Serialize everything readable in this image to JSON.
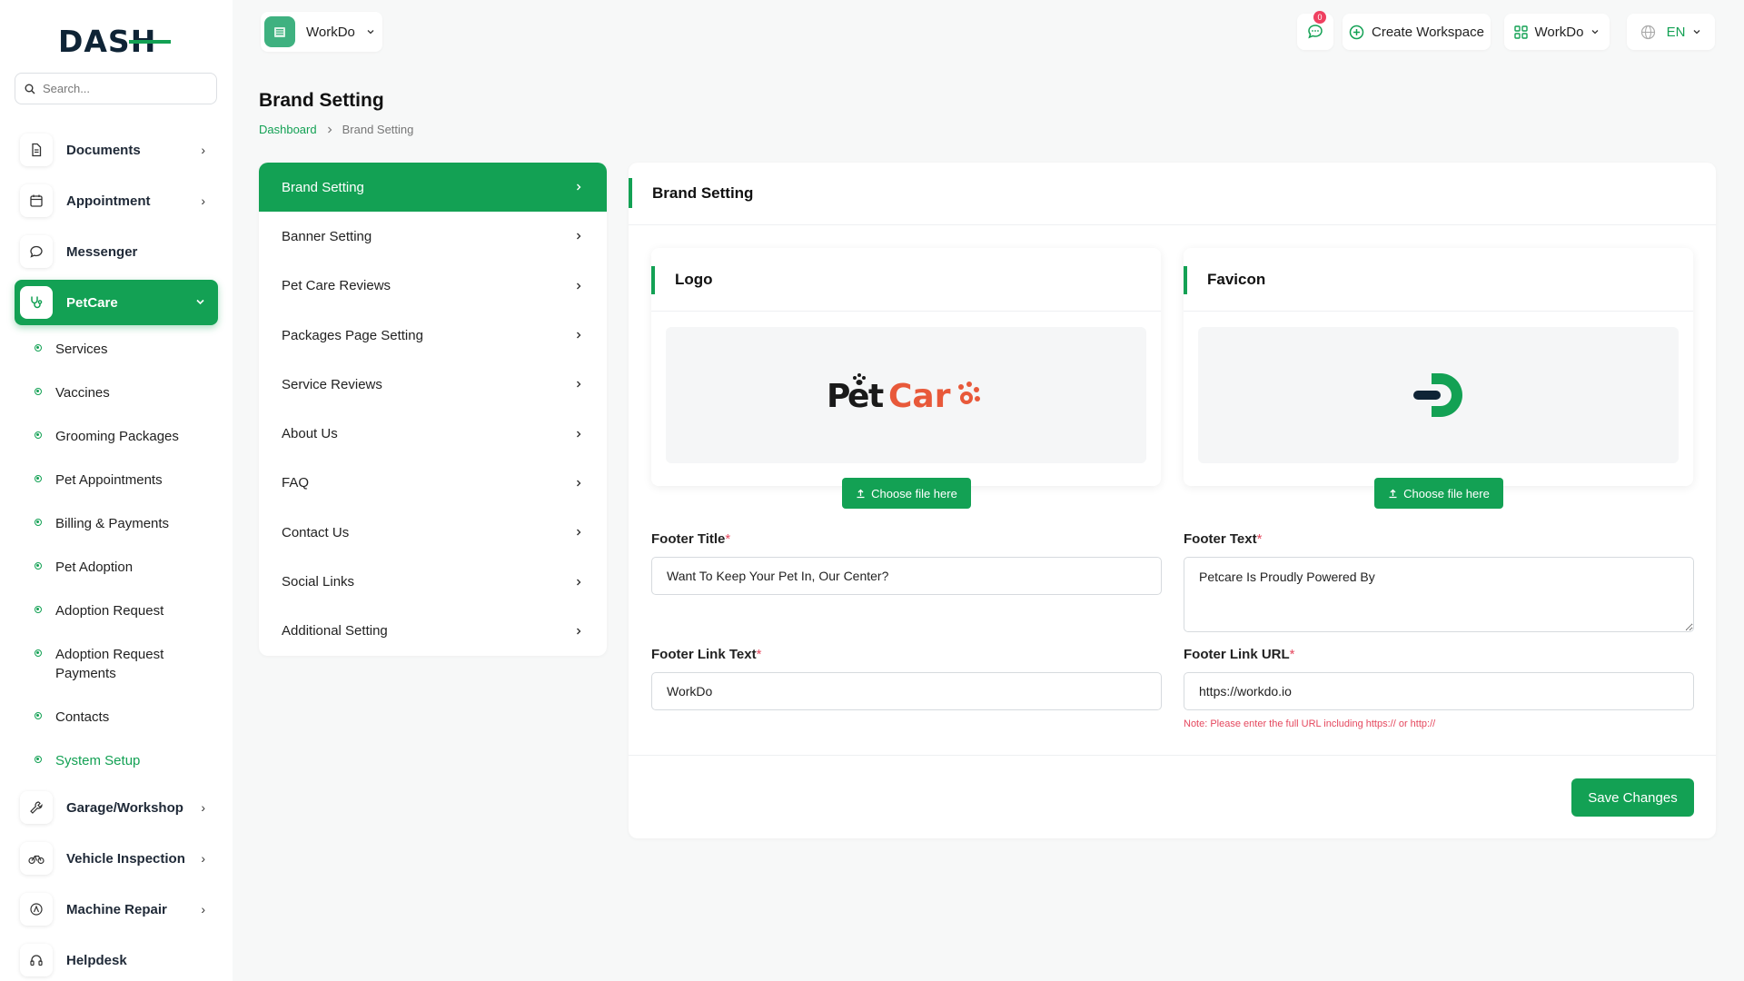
{
  "app": {
    "logo_text": "DASH",
    "search_placeholder": "Search..."
  },
  "sidebar": {
    "items": [
      {
        "label": "Documents"
      },
      {
        "label": "Appointment"
      },
      {
        "label": "Messenger"
      },
      {
        "label": "PetCare"
      },
      {
        "label": "Garage/Workshop"
      },
      {
        "label": "Vehicle Inspection"
      },
      {
        "label": "Machine Repair"
      },
      {
        "label": "Helpdesk"
      }
    ],
    "petcare_sub": [
      {
        "label": "Services"
      },
      {
        "label": "Vaccines"
      },
      {
        "label": "Grooming Packages"
      },
      {
        "label": "Pet Appointments"
      },
      {
        "label": "Billing & Payments"
      },
      {
        "label": "Pet Adoption"
      },
      {
        "label": "Adoption Request"
      },
      {
        "label": "Adoption Request Payments"
      },
      {
        "label": "Contacts"
      },
      {
        "label": "System Setup"
      }
    ]
  },
  "topbar": {
    "workspace_label": "WorkDo",
    "notification_count": "0",
    "create_workspace": "Create Workspace",
    "workspace_menu": "WorkDo",
    "language": "EN"
  },
  "page": {
    "title": "Brand Setting",
    "breadcrumb_home": "Dashboard",
    "breadcrumb_current": "Brand Setting"
  },
  "settings_menu": [
    {
      "label": "Brand Setting"
    },
    {
      "label": "Banner Setting"
    },
    {
      "label": "Pet Care Reviews"
    },
    {
      "label": "Packages Page Setting"
    },
    {
      "label": "Service Reviews"
    },
    {
      "label": "About Us"
    },
    {
      "label": "FAQ"
    },
    {
      "label": "Contact Us"
    },
    {
      "label": "Social Links"
    },
    {
      "label": "Additional Setting"
    }
  ],
  "brand": {
    "card_title": "Brand Setting",
    "logo_title": "Logo",
    "logo_image_text": "PetCare",
    "favicon_title": "Favicon",
    "choose_file": "Choose file here",
    "footer_title_label": "Footer Title",
    "footer_title_value": "Want To Keep Your Pet In, Our Center?",
    "footer_text_label": "Footer Text",
    "footer_text_value": "Petcare Is Proudly Powered By",
    "footer_link_text_label": "Footer Link Text",
    "footer_link_text_value": "WorkDo",
    "footer_link_url_label": "Footer Link URL",
    "footer_link_url_value": "https://workdo.io",
    "url_note": "Note: Please enter the full URL including https:// or http://",
    "required_mark": "*",
    "save_label": "Save Changes"
  },
  "colors": {
    "accent": "#13a154",
    "logo_dark": "#0f2436",
    "petcare_orange": "#e8593a",
    "required": "#e5485e"
  }
}
